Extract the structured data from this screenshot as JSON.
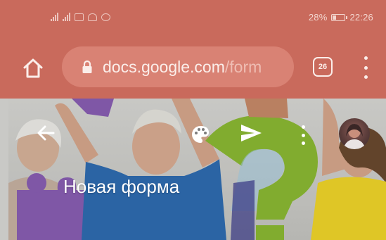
{
  "status_bar": {
    "battery_percent": "28%",
    "battery_level": 0.28,
    "time": "22:26",
    "icons": [
      "signal-icon",
      "signal-icon",
      "message-icon",
      "download-icon",
      "app-icon"
    ]
  },
  "browser": {
    "url_domain": "docs.google.com",
    "url_path": "/form",
    "tab_count": "26",
    "icons": {
      "home": "home-icon",
      "lock": "lock-icon",
      "tabs": "tabs-icon",
      "menu": "more-vert-icon"
    }
  },
  "form": {
    "title": "Новая форма",
    "icons": {
      "back": "arrow-back-icon",
      "palette": "palette-icon",
      "send": "send-icon",
      "more": "more-vert-icon",
      "avatar": "avatar"
    }
  },
  "colors": {
    "toolbar": "#c96a5c",
    "url_pill": "#d98274",
    "toolbar_text": "#fbeeea"
  }
}
